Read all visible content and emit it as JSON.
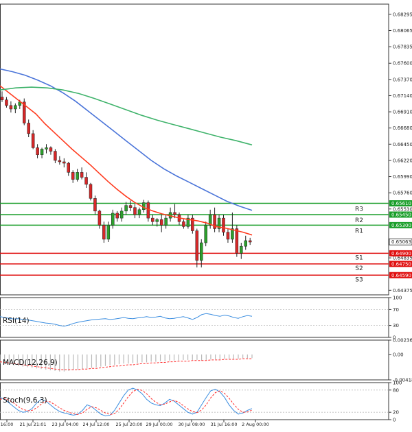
{
  "colors": {
    "up": "#2ca02c",
    "down": "#d62728",
    "ma_red": "#ff3b1f",
    "ma_blue": "#4a74d9",
    "ma_green": "#3fb36b",
    "resistance": "#1a9e2a",
    "support": "#e01010",
    "rsi": "#3a8de0",
    "macd_hist": "#b8b8b8",
    "macd_signal": "#ff2a2a",
    "stoch_k": "#3a8de0",
    "stoch_d": "#ff2a2a"
  },
  "chart_data": [
    {
      "type": "candlestick",
      "price_labels": [
        "0.68295",
        "0.68065",
        "0.67835",
        "0.67600",
        "0.67370",
        "0.67140",
        "0.66910",
        "0.66680",
        "0.66450",
        "0.66220",
        "0.65990",
        "0.65760",
        "0.65530",
        "0.64835",
        "0.64375"
      ],
      "ylim": [
        0.6431,
        0.6844
      ],
      "x_labels": [
        "16:00",
        "21 Jul 21:01",
        "23 Jul 04:00",
        "24 Jul 12:00",
        "25 Jul 20:00",
        "29 Jul 00:00",
        "30 Jul 08:00",
        "31 Jul 16:00",
        "2 Aug 00:00"
      ],
      "current_price": "0.65063",
      "levels": [
        {
          "name": "R3",
          "value": 0.6561,
          "label": "0.65610",
          "kind": "resistance"
        },
        {
          "name": "R2",
          "value": 0.6545,
          "label": "0.65450",
          "kind": "resistance"
        },
        {
          "name": "R1",
          "value": 0.653,
          "label": "0.65300",
          "kind": "resistance"
        },
        {
          "name": "S1",
          "value": 0.649,
          "label": "0.64900",
          "kind": "support"
        },
        {
          "name": "S2",
          "value": 0.6475,
          "label": "0.64750",
          "kind": "support"
        },
        {
          "name": "S3",
          "value": 0.6459,
          "label": "0.64590",
          "kind": "support"
        }
      ],
      "candles": [
        [
          0.6712,
          0.672,
          0.6705,
          0.6708
        ],
        [
          0.6708,
          0.6712,
          0.6697,
          0.67
        ],
        [
          0.67,
          0.6706,
          0.669,
          0.6695
        ],
        [
          0.6695,
          0.6703,
          0.6689,
          0.67
        ],
        [
          0.67,
          0.6708,
          0.6695,
          0.6705
        ],
        [
          0.6705,
          0.671,
          0.6672,
          0.6675
        ],
        [
          0.6675,
          0.668,
          0.6655,
          0.666
        ],
        [
          0.666,
          0.6665,
          0.6638,
          0.664
        ],
        [
          0.664,
          0.6645,
          0.6625,
          0.663
        ],
        [
          0.663,
          0.664,
          0.6625,
          0.6638
        ],
        [
          0.6638,
          0.6645,
          0.6632,
          0.664
        ],
        [
          0.664,
          0.6642,
          0.663,
          0.6635
        ],
        [
          0.6635,
          0.6638,
          0.6618,
          0.6622
        ],
        [
          0.6622,
          0.6628,
          0.6616,
          0.662
        ],
        [
          0.662,
          0.6625,
          0.6612,
          0.6618
        ],
        [
          0.6618,
          0.662,
          0.66,
          0.6605
        ],
        [
          0.6605,
          0.6608,
          0.659,
          0.6595
        ],
        [
          0.6595,
          0.661,
          0.6592,
          0.6605
        ],
        [
          0.6605,
          0.6612,
          0.6595,
          0.6598
        ],
        [
          0.6598,
          0.6605,
          0.6583,
          0.6588
        ],
        [
          0.6588,
          0.659,
          0.6565,
          0.6568
        ],
        [
          0.6568,
          0.6572,
          0.6545,
          0.655
        ],
        [
          0.655,
          0.6552,
          0.6525,
          0.653
        ],
        [
          0.653,
          0.6535,
          0.6505,
          0.651
        ],
        [
          0.651,
          0.6535,
          0.6506,
          0.653
        ],
        [
          0.653,
          0.6552,
          0.6525,
          0.6547
        ],
        [
          0.6547,
          0.655,
          0.6535,
          0.654
        ],
        [
          0.654,
          0.6555,
          0.6535,
          0.655
        ],
        [
          0.655,
          0.6563,
          0.6545,
          0.6558
        ],
        [
          0.6558,
          0.6565,
          0.655,
          0.6555
        ],
        [
          0.6555,
          0.656,
          0.654,
          0.6545
        ],
        [
          0.6545,
          0.6555,
          0.654,
          0.6552
        ],
        [
          0.6552,
          0.6566,
          0.6548,
          0.6562
        ],
        [
          0.6562,
          0.6565,
          0.6535,
          0.654
        ],
        [
          0.654,
          0.6545,
          0.653,
          0.6535
        ],
        [
          0.6535,
          0.654,
          0.6528,
          0.6538
        ],
        [
          0.6538,
          0.6545,
          0.652,
          0.653
        ],
        [
          0.653,
          0.6545,
          0.6525,
          0.654
        ],
        [
          0.654,
          0.6555,
          0.6535,
          0.6548
        ],
        [
          0.6548,
          0.656,
          0.654,
          0.6545
        ],
        [
          0.6545,
          0.6548,
          0.653,
          0.6535
        ],
        [
          0.6535,
          0.6538,
          0.6525,
          0.6528
        ],
        [
          0.6528,
          0.6545,
          0.6525,
          0.654
        ],
        [
          0.654,
          0.6545,
          0.6518,
          0.6522
        ],
        [
          0.6522,
          0.6525,
          0.647,
          0.648
        ],
        [
          0.648,
          0.651,
          0.647,
          0.6505
        ],
        [
          0.6505,
          0.6535,
          0.65,
          0.653
        ],
        [
          0.653,
          0.6552,
          0.6525,
          0.6545
        ],
        [
          0.6545,
          0.6555,
          0.652,
          0.6525
        ],
        [
          0.6525,
          0.6545,
          0.652,
          0.654
        ],
        [
          0.654,
          0.6545,
          0.6515,
          0.652
        ],
        [
          0.652,
          0.6525,
          0.6505,
          0.651
        ],
        [
          0.651,
          0.6548,
          0.6505,
          0.6525
        ],
        [
          0.6525,
          0.653,
          0.6485,
          0.649
        ],
        [
          0.649,
          0.6505,
          0.6482,
          0.65
        ],
        [
          0.65,
          0.6515,
          0.6495,
          0.6508
        ],
        [
          0.6508,
          0.6512,
          0.6502,
          0.6506
        ]
      ],
      "series": [
        {
          "name": "",
          "role": "fast",
          "values": [
            0.6728,
            0.6718,
            0.6708,
            0.6698,
            0.6688,
            0.6674,
            0.6662,
            0.665,
            0.6638,
            0.6627,
            0.6616,
            0.6604,
            0.6592,
            0.6581,
            0.6571,
            0.6562,
            0.6555,
            0.655,
            0.6546,
            0.6543,
            0.654,
            0.6538,
            0.6536,
            0.6533,
            0.6528,
            0.6526,
            0.6523,
            0.652,
            0.6516
          ]
        },
        {
          "name": "",
          "role": "medium",
          "values": [
            0.6752,
            0.6748,
            0.6743,
            0.6736,
            0.6728,
            0.6718,
            0.6706,
            0.6692,
            0.6678,
            0.6664,
            0.665,
            0.6636,
            0.6622,
            0.661,
            0.66,
            0.6591,
            0.6582,
            0.6573,
            0.6564,
            0.6557,
            0.6551
          ]
        },
        {
          "name": "",
          "role": "slow",
          "values": [
            0.6722,
            0.6725,
            0.6726,
            0.6725,
            0.6722,
            0.6717,
            0.671,
            0.6702,
            0.6694,
            0.6686,
            0.6679,
            0.6673,
            0.6667,
            0.6661,
            0.6655,
            0.665,
            0.6644
          ]
        }
      ]
    },
    {
      "type": "line",
      "title": "RSI(14)",
      "labels": [
        "100",
        "70",
        "30",
        "0"
      ],
      "ylim": [
        0,
        100
      ],
      "values": [
        52,
        50,
        48,
        46,
        47,
        45,
        44,
        42,
        40,
        38,
        36,
        35,
        33,
        30,
        28,
        31,
        35,
        38,
        40,
        42,
        44,
        45,
        46,
        47,
        45,
        46,
        48,
        50,
        48,
        47,
        49,
        50,
        52,
        50,
        51,
        53,
        49,
        47,
        48,
        50,
        52,
        49,
        45,
        50,
        57,
        60,
        58,
        55,
        53,
        56,
        54,
        50,
        48,
        52,
        55,
        53
      ]
    },
    {
      "type": "bar",
      "title": "MACD(12,26,9)",
      "labels": [
        "0.002361",
        "0.00",
        "-0.004182"
      ],
      "ylim": [
        -0.004182,
        0.002361
      ],
      "values": [
        -0.0015,
        -0.0016,
        -0.0017,
        -0.0018,
        -0.0019,
        -0.002,
        -0.0021,
        -0.0022,
        -0.0023,
        -0.0024,
        -0.0025,
        -0.0026,
        -0.0027,
        -0.0028,
        -0.0028,
        -0.0027,
        -0.0026,
        -0.0025,
        -0.0024,
        -0.0023,
        -0.0022,
        -0.0021,
        -0.002,
        -0.0019,
        -0.0018,
        -0.0017,
        -0.0016,
        -0.0015,
        -0.0015,
        -0.0014,
        -0.0014,
        -0.0013,
        -0.0013,
        -0.0012,
        -0.0012,
        -0.0011,
        -0.0011,
        -0.001,
        -0.001,
        -0.001,
        -0.0009,
        -0.0009,
        -0.0009,
        -0.0009,
        -0.001,
        -0.0009,
        -0.0008,
        -0.0008,
        -0.0008,
        -0.0007,
        -0.0007,
        -0.0007,
        -0.0007,
        -0.0006,
        -0.0006,
        -0.0006
      ],
      "signal": [
        -0.0012,
        -0.0013,
        -0.0014,
        -0.0015,
        -0.0016,
        -0.0017,
        -0.0018,
        -0.0019,
        -0.002,
        -0.0021,
        -0.0022,
        -0.0023,
        -0.0024,
        -0.0025,
        -0.0025,
        -0.0025,
        -0.0025,
        -0.0025,
        -0.0024,
        -0.0024,
        -0.0023,
        -0.0023,
        -0.0022,
        -0.0021,
        -0.002,
        -0.0019,
        -0.0019,
        -0.0018,
        -0.0017,
        -0.0017,
        -0.0016,
        -0.0015,
        -0.0015,
        -0.0014,
        -0.0014,
        -0.0013,
        -0.0013,
        -0.0012,
        -0.0012,
        -0.0011,
        -0.0011,
        -0.0011,
        -0.001,
        -0.001,
        -0.001,
        -0.001,
        -0.0009,
        -0.0009,
        -0.0009,
        -0.0008,
        -0.0008,
        -0.0008,
        -0.0008,
        -0.0007,
        -0.0007,
        -0.0007
      ]
    },
    {
      "type": "line",
      "title": "Stoch(9,6,3)",
      "labels": [
        "100",
        "80",
        "20",
        "0"
      ],
      "ylim": [
        0,
        100
      ],
      "values": [
        60,
        55,
        45,
        35,
        25,
        20,
        22,
        30,
        45,
        55,
        50,
        40,
        30,
        22,
        18,
        15,
        12,
        15,
        25,
        40,
        35,
        25,
        15,
        10,
        12,
        25,
        45,
        65,
        80,
        85,
        80,
        70,
        55,
        45,
        40,
        38,
        45,
        55,
        50,
        40,
        30,
        20,
        15,
        20,
        40,
        60,
        78,
        82,
        75,
        60,
        40,
        25,
        15,
        18,
        25,
        30
      ],
      "signal": [
        55,
        57,
        52,
        45,
        35,
        28,
        24,
        25,
        32,
        42,
        50,
        48,
        40,
        32,
        25,
        20,
        16,
        14,
        18,
        28,
        35,
        32,
        25,
        18,
        14,
        16,
        28,
        45,
        62,
        76,
        82,
        79,
        70,
        57,
        47,
        41,
        42,
        48,
        52,
        47,
        38,
        29,
        22,
        19,
        26,
        40,
        59,
        73,
        78,
        71,
        58,
        42,
        28,
        20,
        21,
        26
      ]
    }
  ]
}
